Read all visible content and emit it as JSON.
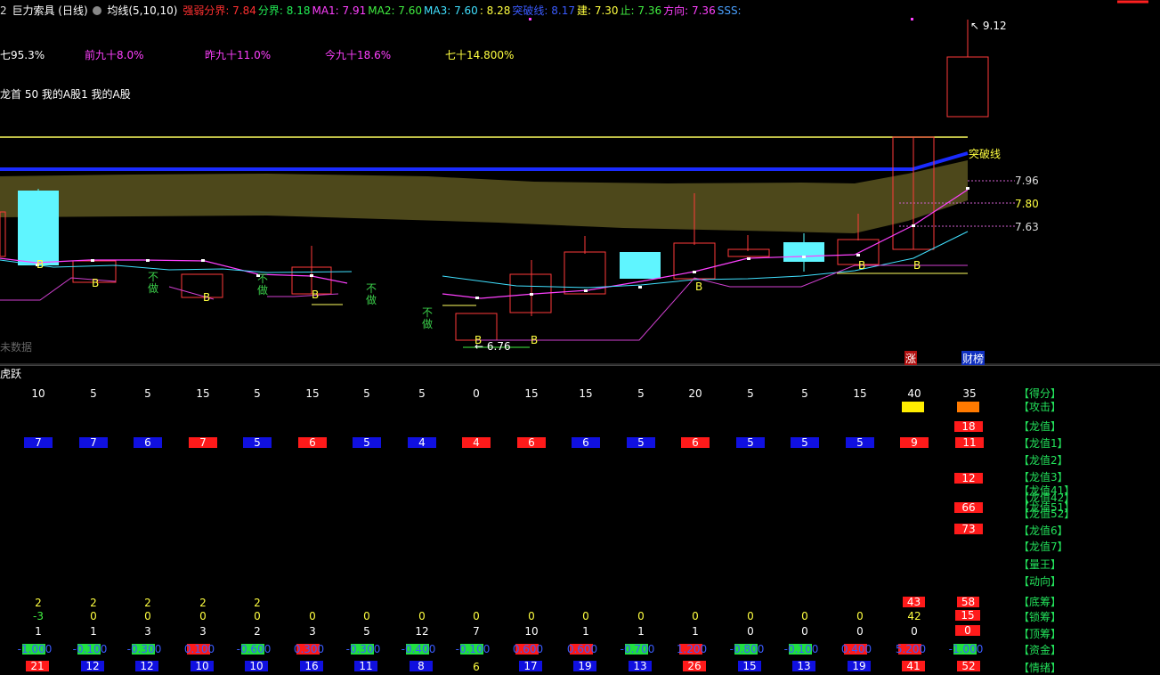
{
  "header": {
    "prefix": "2",
    "stock": "巨力索具 (日线)",
    "ma_label": "均线(5,10,10)",
    "items": [
      {
        "text": "强弱分界: 7.84",
        "color": "#ff3030"
      },
      {
        "text": "分界: 8.18",
        "color": "#22ee55"
      },
      {
        "text": "MA1: 7.91",
        "color": "#ff40ff"
      },
      {
        "text": "MA2: 7.60",
        "color": "#40ee40"
      },
      {
        "text": "MA3: 7.60",
        "color": "#40e0ff"
      },
      {
        "text": ": 8.28",
        "color": "#ffff40"
      },
      {
        "text": "突破线: 8.17",
        "color": "#3a5bff"
      },
      {
        "text": "建: 7.30",
        "color": "#ffff40"
      },
      {
        "text": "止: 7.36",
        "color": "#40ee40"
      },
      {
        "text": "方向: 7.36",
        "color": "#ff40ff"
      },
      {
        "text": "SSS:",
        "color": "#4aa0ff"
      }
    ]
  },
  "stats": [
    {
      "text": "七95.3%",
      "color": "#ffffff"
    },
    {
      "text": "前九十8.0%",
      "color": "#ff40ff"
    },
    {
      "text": "昨九十11.0%",
      "color": "#ff40ff"
    },
    {
      "text": "今九十18.6%",
      "color": "#ff40ff"
    },
    {
      "text": "七十14.800%",
      "color": "#ffff40"
    }
  ],
  "dragon_line": "龙首 50 我的A股1 我的A股",
  "price_labels": {
    "high": "9.12",
    "low": "6.76",
    "l1": "7.96",
    "l2": "7.80",
    "l3": "7.63",
    "breakout": "突破线"
  },
  "no_data": "未数据",
  "markers": {
    "zhang": "涨",
    "caibang": "财榜"
  },
  "buy_label": "B",
  "buzuo": [
    "不",
    "做"
  ],
  "panel_title": "虎跃",
  "colors": {
    "red": "#ff1a1a",
    "blue": "#1010e0",
    "green": "#20e040",
    "label": "#22e05a"
  },
  "rows": {
    "score": [
      "10",
      "5",
      "5",
      "15",
      "5",
      "15",
      "5",
      "5",
      "0",
      "15",
      "15",
      "5",
      "20",
      "5",
      "5",
      "15",
      "40",
      "35"
    ],
    "long1": [
      {
        "v": "7",
        "c": "blue"
      },
      {
        "v": "7",
        "c": "blue"
      },
      {
        "v": "6",
        "c": "blue"
      },
      {
        "v": "7",
        "c": "red"
      },
      {
        "v": "5",
        "c": "blue"
      },
      {
        "v": "6",
        "c": "red"
      },
      {
        "v": "5",
        "c": "blue"
      },
      {
        "v": "4",
        "c": "blue"
      },
      {
        "v": "4",
        "c": "red"
      },
      {
        "v": "6",
        "c": "red"
      },
      {
        "v": "6",
        "c": "blue"
      },
      {
        "v": "5",
        "c": "blue"
      },
      {
        "v": "6",
        "c": "red"
      },
      {
        "v": "5",
        "c": "blue"
      },
      {
        "v": "5",
        "c": "blue"
      },
      {
        "v": "5",
        "c": "blue"
      },
      {
        "v": "9",
        "c": "red"
      },
      {
        "v": "11",
        "c": "red"
      }
    ],
    "last_col": {
      "longzhi": "18",
      "long3": "12",
      "long5": "66",
      "long6": "73",
      "didi": "43",
      "didi2": "58"
    },
    "dichou": [
      "2",
      "2",
      "2",
      "2",
      "2"
    ],
    "suochou": [
      "-3",
      "0",
      "0",
      "0",
      "0",
      "0",
      "0",
      "0",
      "0",
      "0",
      "0",
      "0",
      "0",
      "0",
      "0",
      "0",
      "42",
      "15"
    ],
    "dingchou": [
      "1",
      "1",
      "3",
      "3",
      "2",
      "3",
      "5",
      "12",
      "7",
      "10",
      "1",
      "1",
      "1",
      "0",
      "0",
      "0",
      "0",
      "0"
    ],
    "zijin": [
      {
        "v": "-1.000",
        "c": "green"
      },
      {
        "v": "-0.100",
        "c": "green"
      },
      {
        "v": "-0.300",
        "c": "green"
      },
      {
        "v": "0.100",
        "c": "red"
      },
      {
        "v": "-0.600",
        "c": "green"
      },
      {
        "v": "0.300",
        "c": "red"
      },
      {
        "v": "-0.300",
        "c": "green"
      },
      {
        "v": "-0.400",
        "c": "green"
      },
      {
        "v": "-0.100",
        "c": "green"
      },
      {
        "v": "0.600",
        "c": "red"
      },
      {
        "v": "0.600",
        "c": "red"
      },
      {
        "v": "-0.700",
        "c": "green"
      },
      {
        "v": "1.200",
        "c": "red"
      },
      {
        "v": "-0.800",
        "c": "green"
      },
      {
        "v": "-0.100",
        "c": "green"
      },
      {
        "v": "0.400",
        "c": "red"
      },
      {
        "v": "5.200",
        "c": "red"
      },
      {
        "v": "-1.000",
        "c": "green"
      }
    ],
    "qingxu": [
      {
        "v": "21",
        "c": "red"
      },
      {
        "v": "12",
        "c": "blue"
      },
      {
        "v": "12",
        "c": "blue"
      },
      {
        "v": "10",
        "c": "blue"
      },
      {
        "v": "10",
        "c": "blue"
      },
      {
        "v": "16",
        "c": "blue"
      },
      {
        "v": "11",
        "c": "blue"
      },
      {
        "v": "8",
        "c": "blue"
      },
      {
        "v": "6",
        "c": "none"
      },
      {
        "v": "17",
        "c": "blue"
      },
      {
        "v": "19",
        "c": "blue"
      },
      {
        "v": "13",
        "c": "blue"
      },
      {
        "v": "26",
        "c": "red"
      },
      {
        "v": "15",
        "c": "blue"
      },
      {
        "v": "13",
        "c": "blue"
      },
      {
        "v": "19",
        "c": "blue"
      },
      {
        "v": "41",
        "c": "red"
      },
      {
        "v": "52",
        "c": "red"
      }
    ]
  },
  "labels": [
    "【得分】",
    "【攻击】",
    "【龙值】",
    "【龙值1】",
    "【龙值2】",
    "【龙值3】",
    "【龙值41】",
    "【龙值42】",
    "【龙值51】",
    "【龙值52】",
    "【龙值6】",
    "【龙值7】",
    "【量王】",
    "【动向】",
    "【底筹】",
    "【锁筹】",
    "【顶筹】",
    "【资金】",
    "【情绪】"
  ]
}
